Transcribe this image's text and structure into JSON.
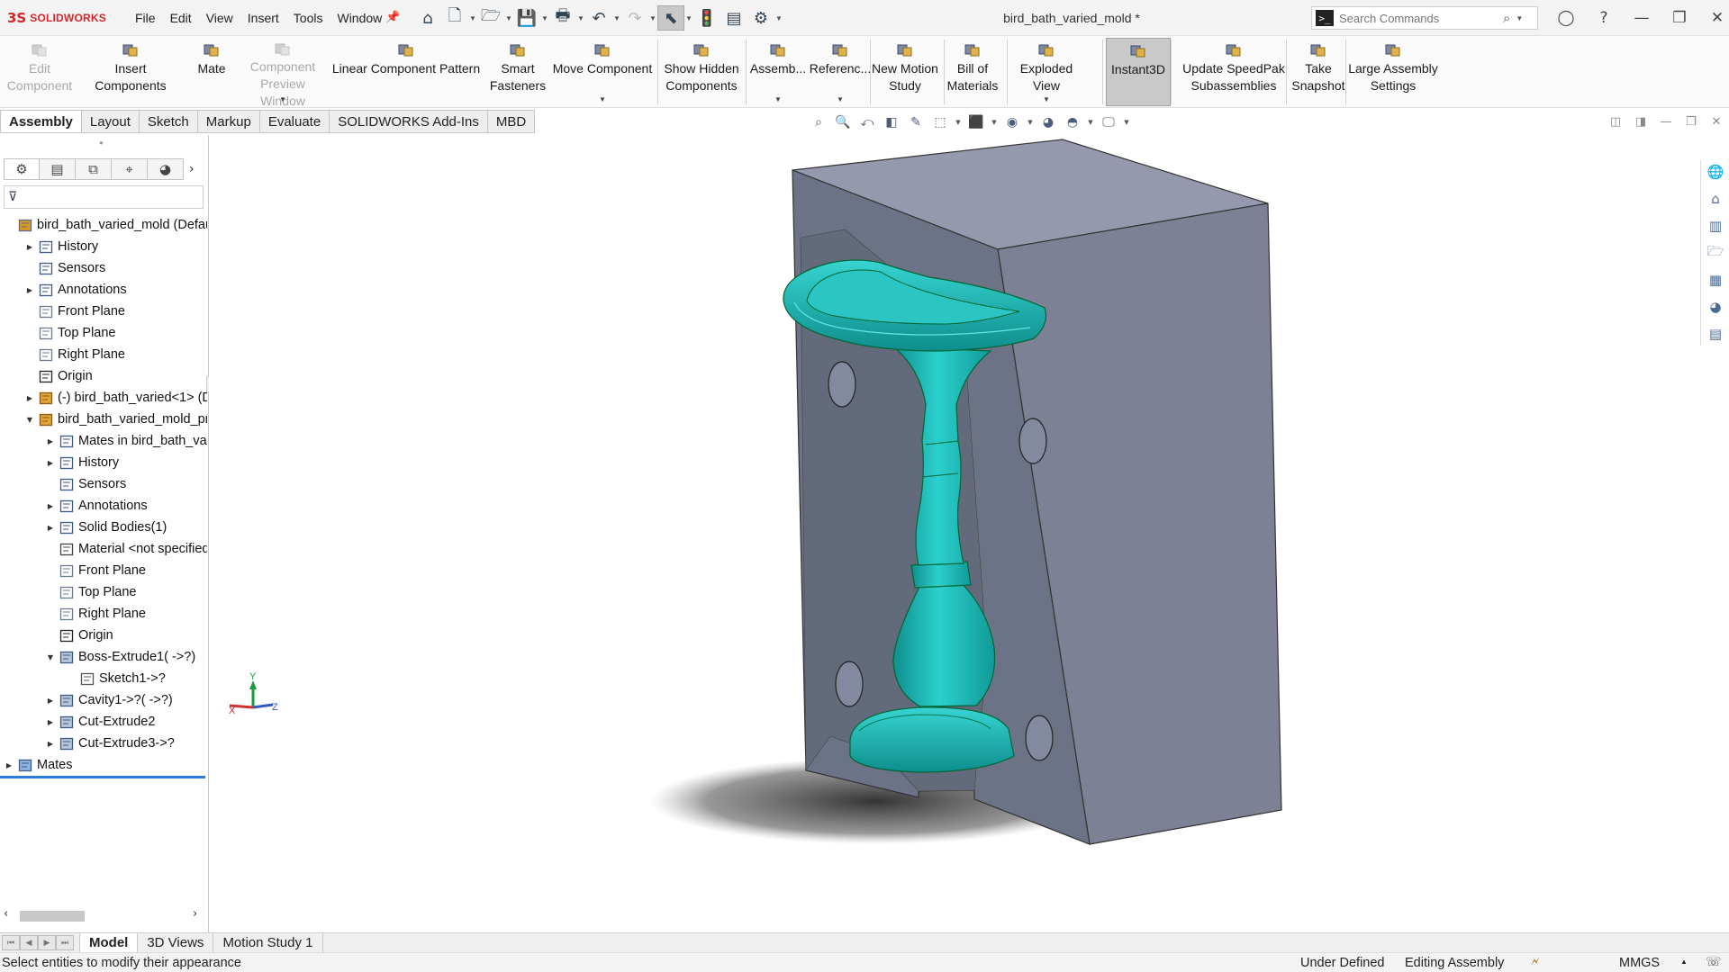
{
  "app": {
    "logo_mark": "3S",
    "logo_text": "SOLIDWORKS",
    "doc_title": "bird_bath_varied_mold *"
  },
  "menu": [
    "File",
    "Edit",
    "View",
    "Insert",
    "Tools",
    "Window"
  ],
  "search": {
    "placeholder": "Search Commands"
  },
  "ribbon": [
    {
      "label": "Edit Component",
      "icon": "edit-component-icon",
      "disabled": true
    },
    {
      "label": "Insert Components",
      "icon": "insert-components-icon"
    },
    {
      "label": "Mate",
      "icon": "mate-icon"
    },
    {
      "label": "Component Preview Window",
      "icon": "component-preview-icon",
      "disabled": true
    },
    {
      "label": "Linear Component Pattern",
      "icon": "linear-pattern-icon"
    },
    {
      "label": "Smart Fasteners",
      "icon": "smart-fasteners-icon"
    },
    {
      "label": "Move Component",
      "icon": "move-component-icon"
    },
    {
      "label": "Show Hidden Components",
      "icon": "show-hidden-icon"
    },
    {
      "label": "Assemb...",
      "icon": "assembly-features-icon"
    },
    {
      "label": "Referenc...",
      "icon": "reference-geometry-icon"
    },
    {
      "label": "New Motion Study",
      "icon": "motion-study-icon"
    },
    {
      "label": "Bill of Materials",
      "icon": "bom-icon"
    },
    {
      "label": "Exploded View",
      "icon": "exploded-view-icon"
    },
    {
      "label": "Instant3D",
      "icon": "instant3d-icon",
      "active": true
    },
    {
      "label": "Update SpeedPak Subassemblies",
      "icon": "speedpak-icon"
    },
    {
      "label": "Take Snapshot",
      "icon": "snapshot-icon"
    },
    {
      "label": "Large Assembly Settings",
      "icon": "large-assembly-icon"
    }
  ],
  "cm_tabs": [
    "Assembly",
    "Layout",
    "Sketch",
    "Markup",
    "Evaluate",
    "SOLIDWORKS Add-Ins",
    "MBD"
  ],
  "tree": [
    {
      "label": "bird_bath_varied_mold  (Defau",
      "icon": "assembly-icon",
      "indent": 0,
      "twisty": ""
    },
    {
      "label": "History",
      "icon": "history-icon",
      "indent": 1,
      "twisty": "▶"
    },
    {
      "label": "Sensors",
      "icon": "sensors-icon",
      "indent": 1,
      "twisty": ""
    },
    {
      "label": "Annotations",
      "icon": "annotations-icon",
      "indent": 1,
      "twisty": "▶"
    },
    {
      "label": "Front Plane",
      "icon": "plane-icon",
      "indent": 1,
      "twisty": ""
    },
    {
      "label": "Top Plane",
      "icon": "plane-icon",
      "indent": 1,
      "twisty": ""
    },
    {
      "label": "Right Plane",
      "icon": "plane-icon",
      "indent": 1,
      "twisty": ""
    },
    {
      "label": "Origin",
      "icon": "origin-icon",
      "indent": 1,
      "twisty": ""
    },
    {
      "label": "(-) bird_bath_varied<1> (D",
      "icon": "part-icon",
      "indent": 1,
      "twisty": "▶"
    },
    {
      "label": "bird_bath_varied_mold_pri",
      "icon": "part-icon",
      "indent": 1,
      "twisty": "▼"
    },
    {
      "label": "Mates in bird_bath_vari",
      "icon": "mates-folder-icon",
      "indent": 2,
      "twisty": "▶"
    },
    {
      "label": "History",
      "icon": "history-icon",
      "indent": 2,
      "twisty": "▶"
    },
    {
      "label": "Sensors",
      "icon": "sensors-icon",
      "indent": 2,
      "twisty": ""
    },
    {
      "label": "Annotations",
      "icon": "annotations-icon",
      "indent": 2,
      "twisty": "▶"
    },
    {
      "label": "Solid Bodies(1)",
      "icon": "solid-bodies-icon",
      "indent": 2,
      "twisty": "▶"
    },
    {
      "label": "Material <not specified",
      "icon": "material-icon",
      "indent": 2,
      "twisty": ""
    },
    {
      "label": "Front Plane",
      "icon": "plane-icon",
      "indent": 2,
      "twisty": ""
    },
    {
      "label": "Top Plane",
      "icon": "plane-icon",
      "indent": 2,
      "twisty": ""
    },
    {
      "label": "Right Plane",
      "icon": "plane-icon",
      "indent": 2,
      "twisty": ""
    },
    {
      "label": "Origin",
      "icon": "origin-icon",
      "indent": 2,
      "twisty": ""
    },
    {
      "label": "Boss-Extrude1( ->?)",
      "icon": "extrude-icon",
      "indent": 2,
      "twisty": "▼"
    },
    {
      "label": "Sketch1->?",
      "icon": "sketch-icon",
      "indent": 3,
      "twisty": ""
    },
    {
      "label": "Cavity1->?( ->?)",
      "icon": "cavity-icon",
      "indent": 2,
      "twisty": "▶"
    },
    {
      "label": "Cut-Extrude2",
      "icon": "cut-extrude-icon",
      "indent": 2,
      "twisty": "▶"
    },
    {
      "label": "Cut-Extrude3->?",
      "icon": "cut-extrude-icon",
      "indent": 2,
      "twisty": "▶"
    },
    {
      "label": "Mates",
      "icon": "mates-icon",
      "indent": 0,
      "twisty": "▶"
    }
  ],
  "triad": {
    "y": "Y",
    "x": "X",
    "z": "Z"
  },
  "bottom_tabs": [
    "Model",
    "3D Views",
    "Motion Study 1"
  ],
  "status": {
    "message": "Select entities to modify their appearance",
    "state": "Under Defined",
    "mode": "Editing Assembly",
    "units": "MMGS"
  },
  "colors": {
    "mold": "#6d7488",
    "mold_top": "#9498ad",
    "mold_side": "#7b8094",
    "part": "#1fb2b0",
    "accent": "#2a7fd4"
  }
}
